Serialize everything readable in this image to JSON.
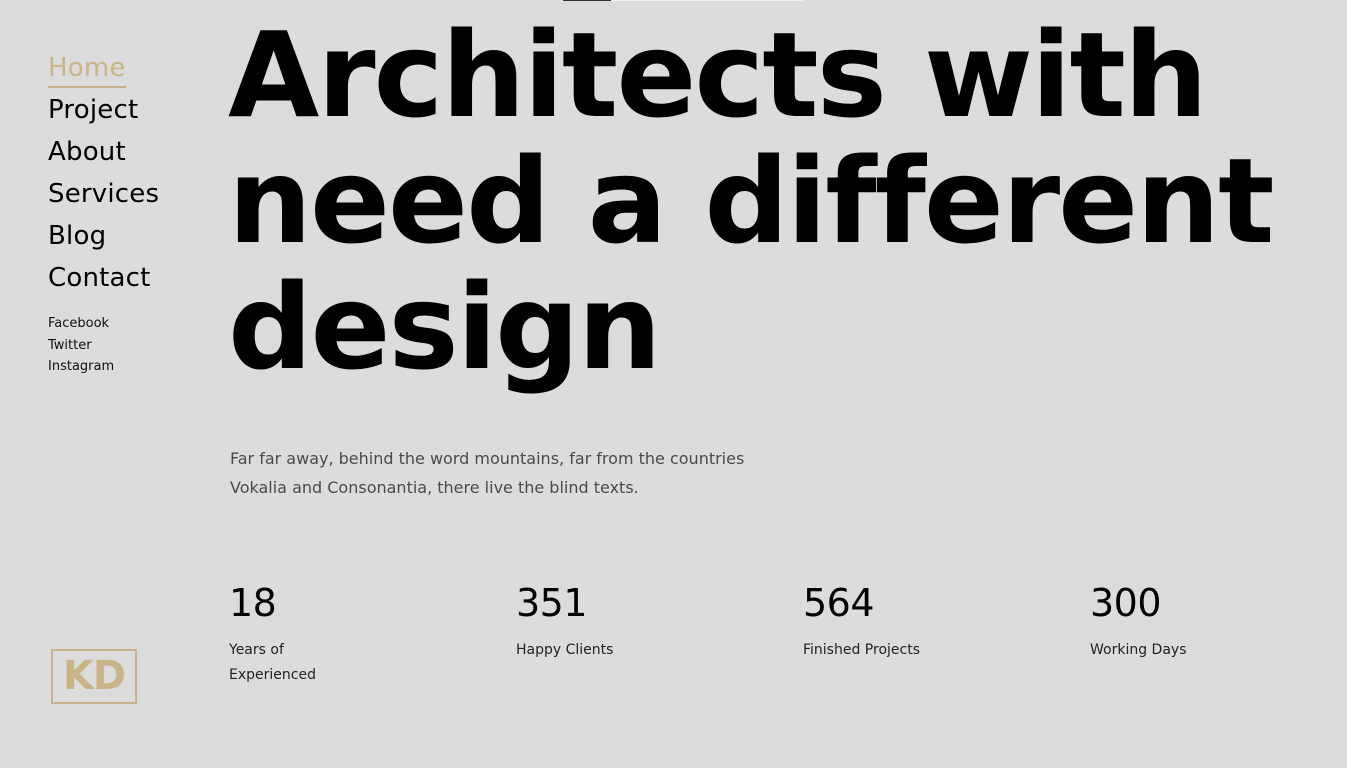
{
  "nav": {
    "items": [
      {
        "label": "Home",
        "active": true
      },
      {
        "label": "Project"
      },
      {
        "label": "About"
      },
      {
        "label": "Services"
      },
      {
        "label": "Blog"
      },
      {
        "label": "Contact"
      }
    ]
  },
  "social": {
    "items": [
      {
        "label": "Facebook"
      },
      {
        "label": "Twitter"
      },
      {
        "label": "Instagram"
      }
    ]
  },
  "logo": {
    "text": "KD"
  },
  "hero": {
    "headline": "Architects with need a different design",
    "intro": "Far far away, behind the word mountains, far from the countries Vokalia and Consonantia, there live the blind texts."
  },
  "stats": [
    {
      "value": "18",
      "label": "Years of Experienced"
    },
    {
      "value": "351",
      "label": "Happy Clients"
    },
    {
      "value": "564",
      "label": "Finished Projects"
    },
    {
      "value": "300",
      "label": "Working Days"
    }
  ],
  "colors": {
    "background": "#dcdcdc",
    "accent": "#c9b48a",
    "text": "#000000",
    "muted_text": "#4a4a4a"
  }
}
